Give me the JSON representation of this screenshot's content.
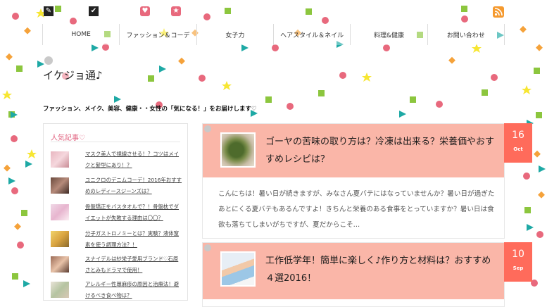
{
  "site": {
    "title": "イケジョ通♪",
    "tagline": "ファッション、メイク、美容、健康・・女性の「気になる！」をお届けします♡"
  },
  "nav": {
    "items": [
      {
        "label": "HOME"
      },
      {
        "label": "ファッション＆コーデ"
      },
      {
        "label": "女子力"
      },
      {
        "label": "ヘアスタイル＆ネイル"
      },
      {
        "label": "料理&健康"
      },
      {
        "label": "お問い合わせ"
      }
    ]
  },
  "top_icons": [
    "edit-icon",
    "checkmark-icon",
    "heart-icon",
    "star-icon",
    "rss-icon"
  ],
  "sidebar": {
    "title": "人気記事♡",
    "items": [
      {
        "text": "マスク美人で視線させる！？コツはメイクと髪型にあり！？"
      },
      {
        "text": "ユニクロのデニムコーデ！2016年おすすめのレディースジーンズは？"
      },
      {
        "text": "骨盤矯正をバスタオルで？！骨盤枕でダイエットが失敗する理由は〇〇？"
      },
      {
        "text": "分子ガストロノミーとは？実験？液体窒素を使う調理方法？！"
      },
      {
        "text": "スナイデルは紗栄子愛用ブランド♡石原さとみもドラマで使用！"
      },
      {
        "text": "アレルギー性蕁麻疹の原因と治療法！避けるべき食べ物は？"
      }
    ]
  },
  "posts": [
    {
      "title": "ゴーヤの苦味の取り方は？冷凍は出来る？栄養価やおすすめレシピは？",
      "excerpt": "こんにちは！暑い日が続きますが、みなさん夏バテにはなっていませんか？暑い日が過ぎたあとにくる夏バテもあるんですよ！きちんと栄養のある食事をとっていますか？暑い日は食欲も落ちてしまいがちですが、夏だからこそ…",
      "day": "16",
      "month": "Oct"
    },
    {
      "title": "工作低学年！簡単に楽しく♪作り方と材料は？おすすめ４選2016！",
      "day": "10",
      "month": "Sep"
    }
  ],
  "colors": {
    "accent_header": "#fab6a8",
    "date_badge": "#ff6b5b",
    "sidebar_title": "#e0607e"
  }
}
